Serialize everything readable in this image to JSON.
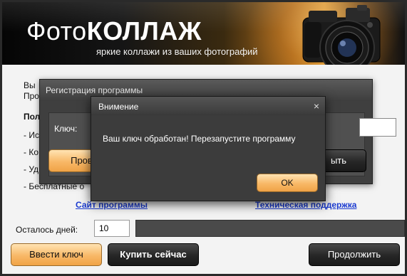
{
  "header": {
    "logo_part1": "Фото",
    "logo_part2": "КОЛЛАЖ",
    "tagline": "яркие коллажи из ваших фотографий"
  },
  "intro": {
    "line1": "Вы",
    "line2": "Про",
    "bold": "Пол",
    "bullets": [
      "- Ис",
      "- Ко",
      "- Уд",
      "- Бесплатные о"
    ]
  },
  "links": {
    "site": "Сайт программы",
    "support": "Техническая поддержка"
  },
  "days": {
    "label": "Осталось дней:",
    "value": "10"
  },
  "buttons": {
    "enter_key": "Ввести ключ",
    "buy_now": "Купить сейчас",
    "continue": "Продолжить"
  },
  "registration": {
    "title": "Регистрация программы",
    "key_label": "Ключ:",
    "left_button": "Прове",
    "right_button": "ыть"
  },
  "notice": {
    "title": "Внимение",
    "close": "×",
    "message": "Ваш ключ обработан! Перезапустите программу",
    "ok": "OK"
  },
  "colors": {
    "accent_orange": "#f8b867",
    "dark_button": "#262626",
    "link_blue": "#1b3bd1"
  }
}
